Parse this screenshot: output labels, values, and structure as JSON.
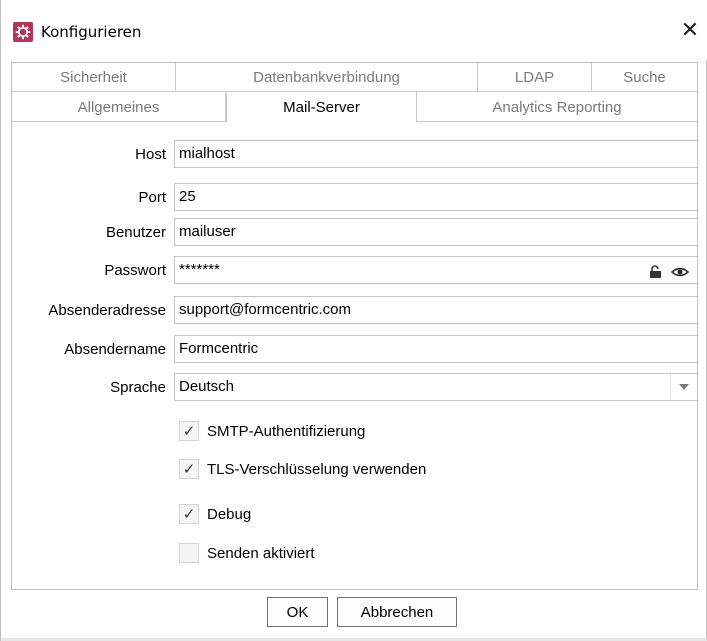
{
  "window": {
    "title": "Konfigurieren",
    "close_glyph": "✕",
    "app_icon": "gear-icon",
    "app_icon_color": "#b8325a"
  },
  "tabs": {
    "row1": [
      {
        "label": "Sicherheit"
      },
      {
        "label": "Datenbankverbindung"
      },
      {
        "label": "LDAP"
      },
      {
        "label": "Suche"
      }
    ],
    "row2": [
      {
        "label": "Allgemeines"
      },
      {
        "label": "Mail-Server",
        "active": true
      },
      {
        "label": "Analytics Reporting"
      }
    ]
  },
  "form": {
    "host": {
      "label": "Host",
      "value": "mialhost"
    },
    "port": {
      "label": "Port",
      "value": "25"
    },
    "user": {
      "label": "Benutzer",
      "value": "mailuser"
    },
    "password": {
      "label": "Passwort",
      "value": "*******",
      "icons": [
        "lock-open-icon",
        "eye-icon"
      ]
    },
    "sender_address": {
      "label": "Absenderadresse",
      "value": "support@formcentric.com"
    },
    "sender_name": {
      "label": "Absendername",
      "value": "Formcentric"
    },
    "language": {
      "label": "Sprache",
      "value": "Deutsch"
    }
  },
  "checkboxes": [
    {
      "label": "SMTP-Authentifizierung",
      "checked": true,
      "mark": "✓"
    },
    {
      "label": "TLS-Verschlüsselung verwenden",
      "checked": true,
      "mark": "✓"
    },
    {
      "label": "Debug",
      "checked": true,
      "mark": "✓"
    },
    {
      "label": "Senden aktiviert",
      "checked": false,
      "mark": ""
    }
  ],
  "buttons": {
    "ok": "OK",
    "cancel": "Abbrechen"
  }
}
